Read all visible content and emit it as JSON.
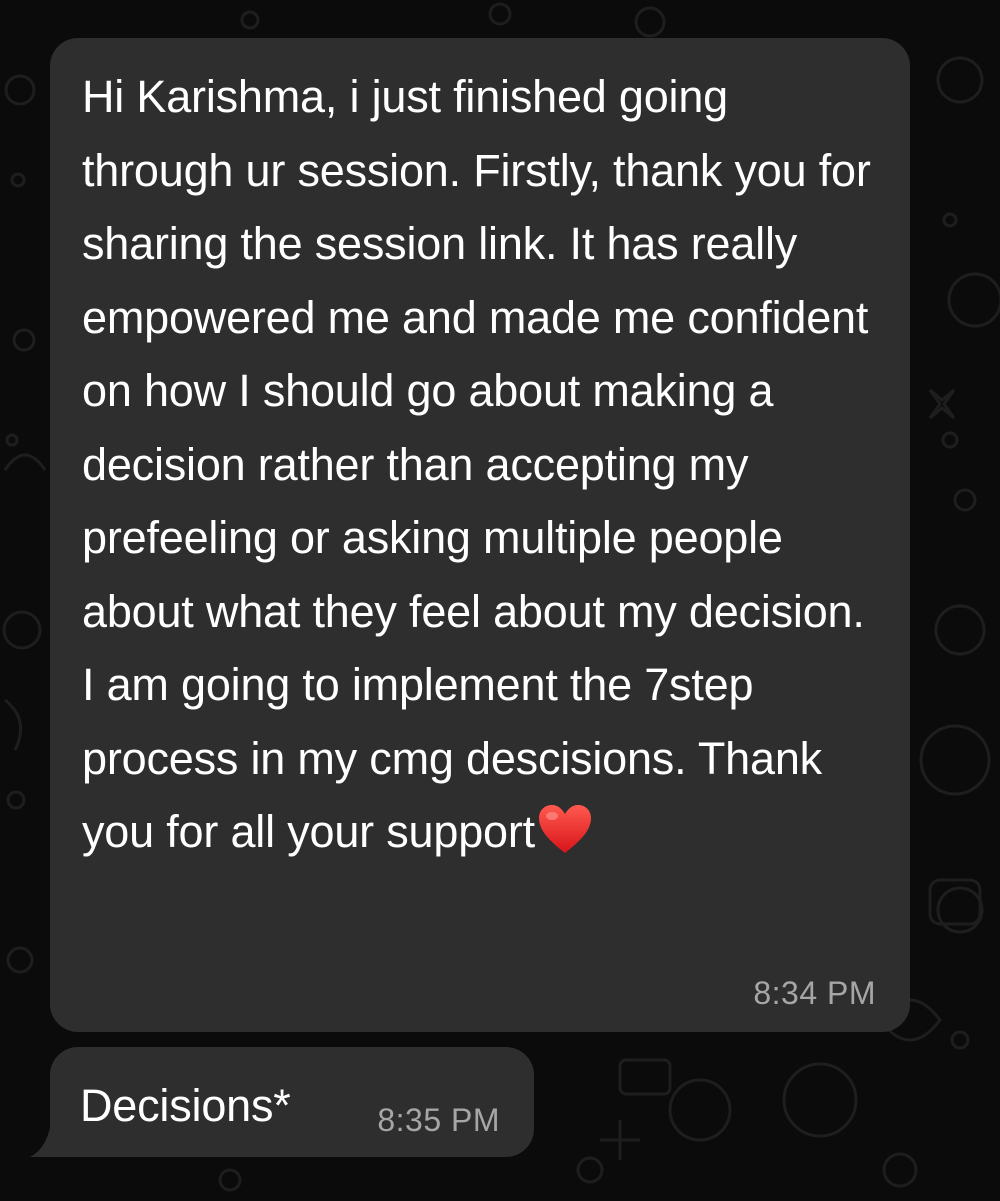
{
  "messages": [
    {
      "text": "Hi Karishma, i just finished going through ur session. Firstly, thank you for sharing the session link. It has really empowered me and made me confident on how I should go about making a decision rather than accepting my prefeeling or asking multiple people about what they feel about my decision.  I am going to implement the 7step process in my cmg descisions. Thank you for all your support",
      "emoji": "red-heart-icon",
      "time": "8:34 PM"
    },
    {
      "text": "Decisions*",
      "time": "8:35 PM"
    }
  ],
  "colors": {
    "background": "#0b0b0b",
    "bubble": "#2e2e2e",
    "text": "#ffffff",
    "timestamp": "#a6a6a6",
    "doodle": "#1f1f1f"
  }
}
